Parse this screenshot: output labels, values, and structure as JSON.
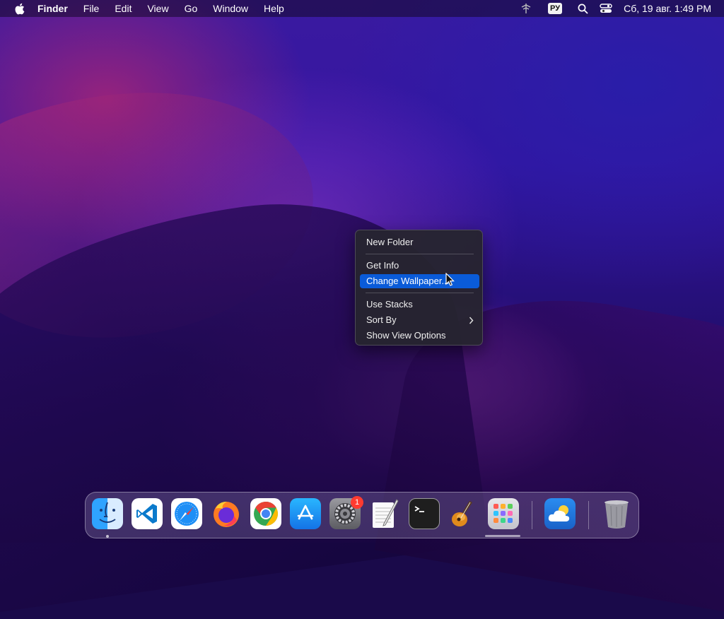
{
  "menubar": {
    "apple_icon": "apple-icon",
    "app_name": "Finder",
    "menus": [
      "File",
      "Edit",
      "View",
      "Go",
      "Window",
      "Help"
    ],
    "input_source": "РУ",
    "clock": "Сб, 19 авг.  1:49 PM"
  },
  "context_menu": {
    "items": [
      {
        "label": "New Folder"
      },
      {
        "label": "Get Info"
      },
      {
        "label": "Change Wallpaper...",
        "highlighted": true
      },
      {
        "label": "Use Stacks"
      },
      {
        "label": "Sort By",
        "submenu": true
      },
      {
        "label": "Show View Options"
      }
    ]
  },
  "dock": {
    "apps": [
      {
        "name": "Finder",
        "icon": "finder-icon",
        "running": true
      },
      {
        "name": "Visual Studio Code",
        "icon": "vscode-icon"
      },
      {
        "name": "Safari",
        "icon": "safari-icon"
      },
      {
        "name": "Firefox",
        "icon": "firefox-icon"
      },
      {
        "name": "Google Chrome",
        "icon": "chrome-icon"
      },
      {
        "name": "App Store",
        "icon": "app-store-icon"
      },
      {
        "name": "System Settings",
        "icon": "system-settings-icon",
        "badge": "1"
      },
      {
        "name": "TextEdit",
        "icon": "textedit-icon"
      },
      {
        "name": "Terminal",
        "icon": "terminal-icon"
      },
      {
        "name": "GarageBand",
        "icon": "garageband-icon"
      },
      {
        "name": "Launchpad",
        "icon": "launchpad-icon"
      },
      {
        "name": "Weather",
        "icon": "weather-icon"
      },
      {
        "name": "Trash",
        "icon": "trash-icon"
      }
    ]
  },
  "colors": {
    "menu_highlight": "#0a5bd8",
    "badge": "#ff3b30"
  }
}
